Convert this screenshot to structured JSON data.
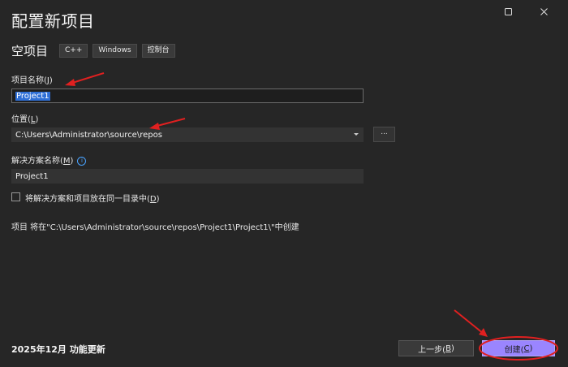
{
  "dialog": {
    "title": "配置新项目",
    "template_name": "空项目",
    "tags": [
      "C++",
      "Windows",
      "控制台"
    ]
  },
  "fields": {
    "project_name": {
      "label_prefix": "项目名称(",
      "label_key": "J",
      "label_suffix": ")",
      "value": "Project1"
    },
    "location": {
      "label_prefix": "位置(",
      "label_key": "L",
      "label_suffix": ")",
      "value": "C:\\Users\\Administrator\\source\\repos"
    },
    "browse_label": "...",
    "solution_name": {
      "label_prefix": "解决方案名称(",
      "label_key": "M",
      "label_suffix": ")",
      "value": "Project1"
    },
    "same_directory": {
      "label_prefix": "将解决方案和项目放在同一目录中(",
      "label_key": "D",
      "label_suffix": ")",
      "checked": false
    }
  },
  "path_info": "项目 将在\"C:\\Users\\Administrator\\source\\repos\\Project1\\Project1\\\"中创建",
  "footer": {
    "update_note": "2025年12月 功能更新",
    "back_label_prefix": "上一步(",
    "back_label_key": "B",
    "back_label_suffix": ")",
    "create_label_prefix": "创建(",
    "create_label_key": "C",
    "create_label_suffix": ")"
  },
  "colors": {
    "background": "#262626",
    "accent_button": "#9a85ff",
    "annotation": "#e02020",
    "selection": "#2f6fd6"
  },
  "icons": [
    "maximize-icon",
    "close-icon",
    "dropdown-arrow-icon",
    "info-icon"
  ]
}
